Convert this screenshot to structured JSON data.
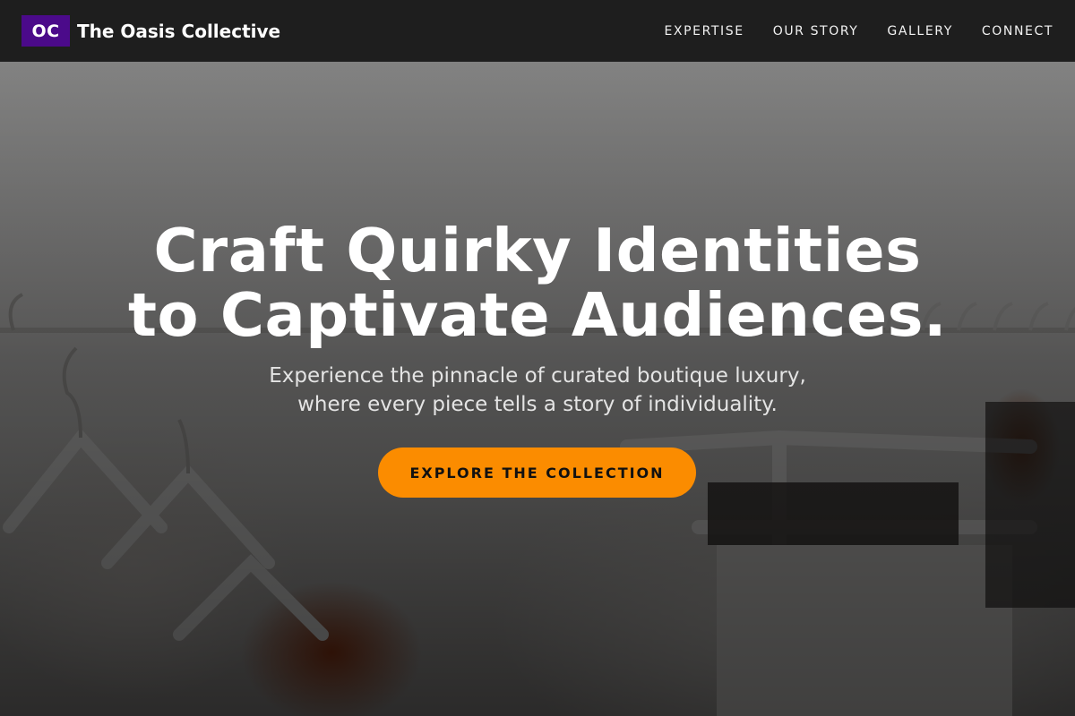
{
  "brand": {
    "logo_text": "OC",
    "name": "The Oasis Collective",
    "logo_color": "#4b0a8a"
  },
  "nav": {
    "items": [
      {
        "label": "EXPERTISE"
      },
      {
        "label": "OUR STORY"
      },
      {
        "label": "GALLERY"
      },
      {
        "label": "CONNECT"
      }
    ]
  },
  "hero": {
    "title_line1": "Craft Quirky Identities",
    "title_line2": "to Captivate Audiences.",
    "subtitle_line1": "Experience the pinnacle of curated boutique luxury,",
    "subtitle_line2": "where every piece tells a story of individuality.",
    "cta_label": "EXPLORE THE COLLECTION",
    "cta_color": "#fb8c00",
    "background": "clothing-rack-with-hangers-photo"
  }
}
